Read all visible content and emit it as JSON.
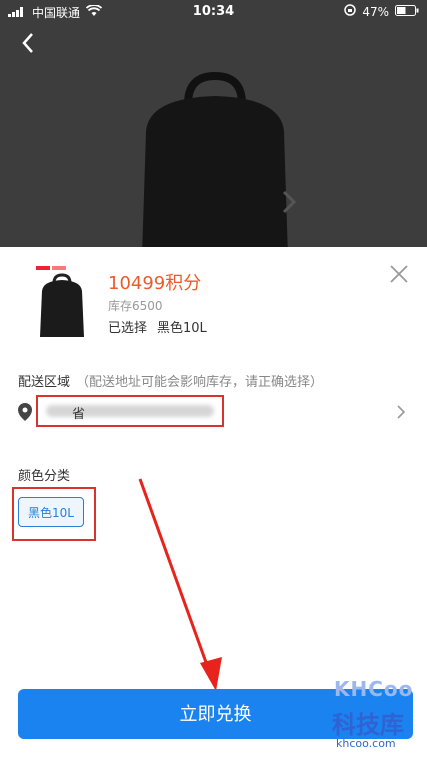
{
  "status_bar": {
    "carrier": "中国联通",
    "time": "10:34",
    "battery": "47%"
  },
  "product": {
    "points": "10499积分",
    "stock": "库存6500",
    "selected_label": "已选择",
    "selected_value": "黑色10L"
  },
  "shipping": {
    "title": "配送区域",
    "hint": "（配送地址可能会影响库存，请正确选择）",
    "address_visible": "省"
  },
  "color": {
    "title": "颜色分类",
    "options": [
      "黑色10L"
    ]
  },
  "action": {
    "exchange_label": "立即兑换"
  },
  "watermark": {
    "brand": "KHCoo",
    "cn": "科技库",
    "url": "khcoo.com"
  },
  "colors": {
    "accent_blue": "#1a83f0",
    "points_orange": "#f05a2a",
    "annotation_red": "#d9342b"
  }
}
